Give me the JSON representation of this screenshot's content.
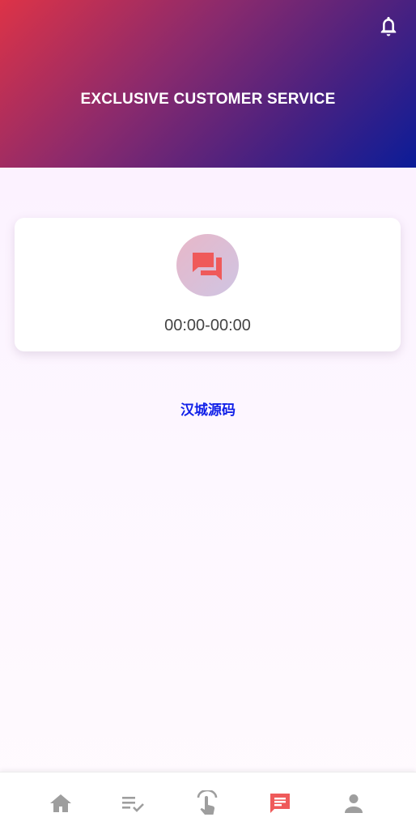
{
  "header": {
    "title": "EXCLUSIVE CUSTOMER SERVICE",
    "bell_icon": "bell-icon"
  },
  "service_card": {
    "icon": "chat-icon",
    "hours": "00:00-00:00"
  },
  "brand_text": "汉城源码",
  "tabbar": {
    "items": [
      {
        "icon": "home-icon",
        "active": false
      },
      {
        "icon": "checklist-icon",
        "active": false
      },
      {
        "icon": "touch-icon",
        "active": false
      },
      {
        "icon": "message-icon",
        "active": true
      },
      {
        "icon": "person-icon",
        "active": false
      }
    ]
  },
  "colors": {
    "header_gradient_start": "#dd3347",
    "header_gradient_end": "#0b1c98",
    "accent": "#ef5a5a",
    "brand_text": "#1020e8",
    "inactive_tab": "#9e9e9e"
  }
}
